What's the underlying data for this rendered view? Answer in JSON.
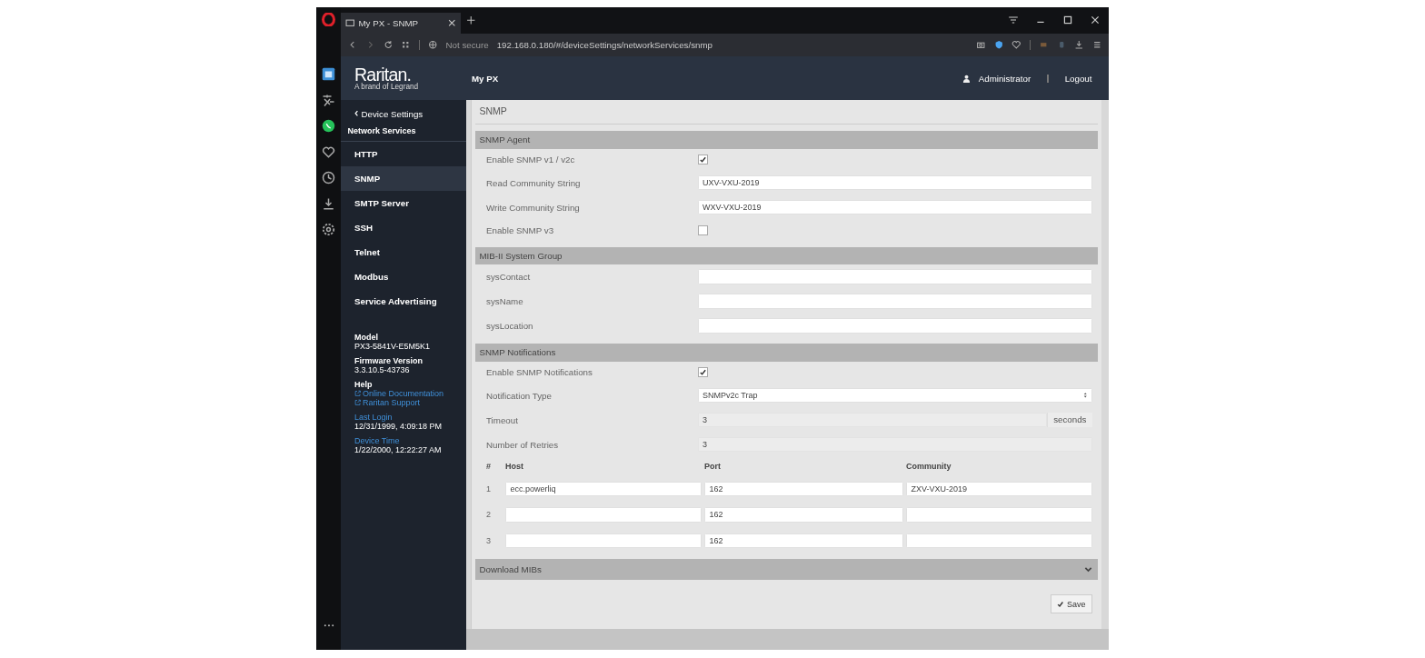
{
  "browser": {
    "tab_title": "My PX - SNMP",
    "security": "Not secure",
    "url": "192.168.0.180/#/deviceSettings/networkServices/snmp"
  },
  "header": {
    "logo": "Raritan.",
    "tagline": "A brand of Legrand",
    "product": "My PX",
    "user": "Administrator",
    "logout": "Logout"
  },
  "sidebar": {
    "back": "Device Settings",
    "section": "Network Services",
    "items": [
      {
        "label": "HTTP",
        "selected": false
      },
      {
        "label": "SNMP",
        "selected": true
      },
      {
        "label": "SMTP Server",
        "selected": false
      },
      {
        "label": "SSH",
        "selected": false
      },
      {
        "label": "Telnet",
        "selected": false
      },
      {
        "label": "Modbus",
        "selected": false
      },
      {
        "label": "Service Advertising",
        "selected": false
      }
    ],
    "info": [
      {
        "kind": "text",
        "label": "Model",
        "value": "PX3-5841V-E5M5K1"
      },
      {
        "kind": "text",
        "label": "Firmware Version",
        "value": "3.3.10.5-43736"
      },
      {
        "kind": "links",
        "label": "Help",
        "links": [
          "Online Documentation",
          "Raritan Support"
        ]
      },
      {
        "kind": "link_label",
        "label": "Last Login",
        "value": "12/31/1999, 4:09:18 PM"
      },
      {
        "kind": "link_label",
        "label": "Device Time",
        "value": "1/22/2000, 12:22:27 AM"
      }
    ]
  },
  "content": {
    "title": "SNMP",
    "sections": [
      {
        "title": "SNMP Agent",
        "rows": [
          {
            "kind": "checkbox",
            "label": "Enable SNMP v1 / v2c",
            "checked": true
          },
          {
            "kind": "text",
            "label": "Read Community String",
            "value": "UXV-VXU-2019"
          },
          {
            "kind": "text",
            "label": "Write Community String",
            "value": "WXV-VXU-2019"
          },
          {
            "kind": "checkbox",
            "label": "Enable SNMP v3",
            "checked": false
          }
        ]
      },
      {
        "title": "MIB-II System Group",
        "rows": [
          {
            "kind": "text",
            "label": "sysContact"
          },
          {
            "kind": "text",
            "label": "sysName"
          },
          {
            "kind": "text",
            "label": "sysLocation"
          }
        ]
      },
      {
        "title": "SNMP Notifications",
        "rows": [
          {
            "kind": "checkbox",
            "label": "Enable SNMP Notifications",
            "checked": true
          },
          {
            "kind": "select",
            "label": "Notification Type",
            "value": "SNMPv2c Trap"
          },
          {
            "kind": "readonly",
            "label": "Timeout",
            "value": "3",
            "unit": "seconds"
          },
          {
            "kind": "readonly",
            "label": "Number of Retries",
            "value": "3"
          }
        ],
        "table": {
          "columns": [
            "#",
            "Host",
            "Port",
            "Community"
          ],
          "rows": [
            [
              "1",
              "ecc.powerliq",
              "162",
              "ZXV-VXU-2019"
            ],
            [
              "2",
              "",
              "162",
              ""
            ],
            [
              "3",
              "",
              "162",
              ""
            ]
          ]
        }
      }
    ],
    "collapsed": {
      "title": "Download MIBs",
      "expanded": false
    },
    "save": "Save"
  }
}
